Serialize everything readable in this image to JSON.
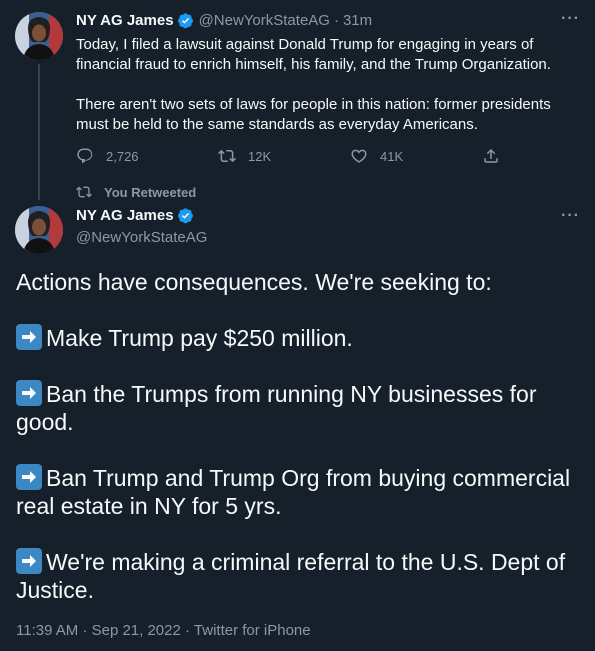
{
  "tweet1": {
    "name": "NY AG James",
    "handle": "@NewYorkStateAG",
    "time": "31m",
    "separator": "·",
    "more": "···",
    "paragraphs": [
      "Today, I filed a lawsuit against Donald Trump for engaging in years of financial fraud to enrich himself, his family, and the Trump Organization.",
      "There aren't two sets of laws for people in this nation: former presidents must be held to the same standards as everyday Americans."
    ],
    "replies": "2,726",
    "retweets": "12K",
    "likes": "41K",
    "icons": {
      "reply": "reply-icon",
      "retweet": "retweet-icon",
      "like": "heart-icon",
      "share": "share-icon"
    }
  },
  "retweet_note": "You Retweeted",
  "tweet2": {
    "name": "NY AG James",
    "handle": "@NewYorkStateAG",
    "more": "···",
    "lines": [
      {
        "arrow": false,
        "text": "Actions have consequences. We're seeking to:"
      },
      {
        "arrow": true,
        "text": "Make Trump pay $250 million."
      },
      {
        "arrow": true,
        "text": "Ban the Trumps from running NY businesses for good."
      },
      {
        "arrow": true,
        "text": "Ban Trump and Trump Org from buying commercial real estate in NY for 5 yrs."
      },
      {
        "arrow": true,
        "text": "We're making a criminal referral to the U.S. Dept of Justice."
      }
    ],
    "meta": "11:39 AM · Sep 21, 2022 · Twitter for iPhone"
  },
  "colors": {
    "background": "#15202b",
    "text": "#f7f9f9",
    "secondary": "#8b98a5",
    "verified": "#1d9bf0",
    "arrow_emoji": "#3b88c3"
  }
}
